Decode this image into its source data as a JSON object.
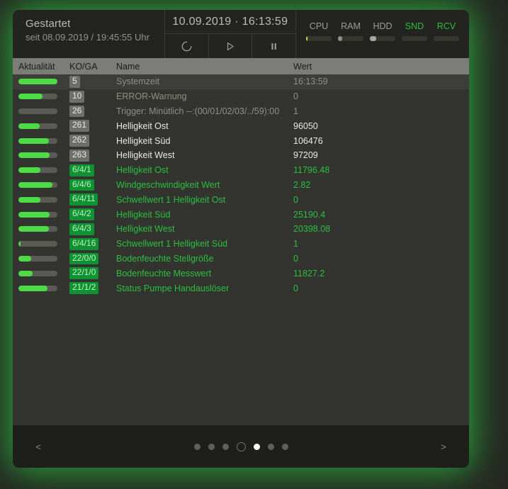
{
  "header": {
    "status_title": "Gestartet",
    "status_sub": "seit 08.09.2019 / 19:45:55 Uhr",
    "clock": "10.09.2019 · 16:13:59",
    "transport": [
      {
        "name": "refresh-button",
        "icon": "refresh-icon"
      },
      {
        "name": "play-button",
        "icon": "play-icon"
      },
      {
        "name": "pause-button",
        "icon": "pause-icon"
      }
    ],
    "sysmon": [
      {
        "label": "CPU",
        "active": true,
        "fill_pct": 6,
        "color": "#d8d84a"
      },
      {
        "label": "RAM",
        "active": false,
        "fill_pct": 18,
        "color": "#8e9189"
      },
      {
        "label": "HDD",
        "active": false,
        "fill_pct": 26,
        "color": "#a6a9a0"
      },
      {
        "label": "SND",
        "active": true,
        "fill_pct": 0,
        "color": "#2cbf3f"
      },
      {
        "label": "RCV",
        "active": true,
        "fill_pct": 0,
        "color": "#2cbf3f"
      }
    ]
  },
  "table": {
    "columns": {
      "aktualitaet": "Aktualität",
      "koga": "KO/GA",
      "name": "Name",
      "wert": "Wert"
    },
    "rows": [
      {
        "bar_pct": 100,
        "koga": "5",
        "badge": "gray",
        "name": "Systemzeit",
        "value": "16:13:59",
        "tone": "dim",
        "highlight": true
      },
      {
        "bar_pct": 62,
        "koga": "10",
        "badge": "gray",
        "name": "ERROR-Warnung",
        "value": "0",
        "tone": "dim",
        "highlight": false
      },
      {
        "bar_pct": 0,
        "koga": "26",
        "badge": "gray",
        "name": "Trigger: Minütlich --:(00/01/02/03/../59):00",
        "value": "1",
        "tone": "dim",
        "highlight": false
      },
      {
        "bar_pct": 55,
        "koga": "261",
        "badge": "gray",
        "name": "Helligkeit Ost",
        "value": "96050",
        "tone": "white",
        "highlight": false
      },
      {
        "bar_pct": 78,
        "koga": "262",
        "badge": "gray",
        "name": "Helligkeit Süd",
        "value": "106476",
        "tone": "white",
        "highlight": false
      },
      {
        "bar_pct": 80,
        "koga": "263",
        "badge": "gray",
        "name": "Helligkeit West",
        "value": "97209",
        "tone": "white",
        "highlight": false
      },
      {
        "bar_pct": 56,
        "koga": "6/4/1",
        "badge": "green",
        "name": "Helligkeit Ost",
        "value": "11796.48",
        "tone": "green",
        "highlight": false
      },
      {
        "bar_pct": 88,
        "koga": "6/4/6",
        "badge": "green",
        "name": "Windgeschwindigkeit Wert",
        "value": "2.82",
        "tone": "green",
        "highlight": false
      },
      {
        "bar_pct": 56,
        "koga": "6/4/11",
        "badge": "green",
        "name": "Schwellwert 1 Helligkeit Ost",
        "value": "0",
        "tone": "green",
        "highlight": false
      },
      {
        "bar_pct": 80,
        "koga": "6/4/2",
        "badge": "green",
        "name": "Helligkeit Süd",
        "value": "25190.4",
        "tone": "green",
        "highlight": false
      },
      {
        "bar_pct": 78,
        "koga": "6/4/3",
        "badge": "green",
        "name": "Helligkeit West",
        "value": "20398.08",
        "tone": "green",
        "highlight": false
      },
      {
        "bar_pct": 6,
        "koga": "6/4/16",
        "badge": "green",
        "name": "Schwellwert 1 Helligkeit Süd",
        "value": "1",
        "tone": "green",
        "highlight": false
      },
      {
        "bar_pct": 33,
        "koga": "22/0/0",
        "badge": "green",
        "name": "Bodenfeuchte Stellgröße",
        "value": "0",
        "tone": "green",
        "highlight": false
      },
      {
        "bar_pct": 36,
        "koga": "22/1/0",
        "badge": "green",
        "name": "Bodenfeuchte Messwert",
        "value": "11827.2",
        "tone": "green",
        "highlight": false
      },
      {
        "bar_pct": 74,
        "koga": "21/1/2",
        "badge": "green",
        "name": "Status Pumpe Handauslöser",
        "value": "0",
        "tone": "green",
        "highlight": false
      }
    ]
  },
  "footer": {
    "prev_label": "<",
    "next_label": ">",
    "pages": [
      {
        "state": "normal"
      },
      {
        "state": "normal"
      },
      {
        "state": "normal"
      },
      {
        "state": "ring"
      },
      {
        "state": "active"
      },
      {
        "state": "normal"
      },
      {
        "state": "normal"
      }
    ]
  }
}
